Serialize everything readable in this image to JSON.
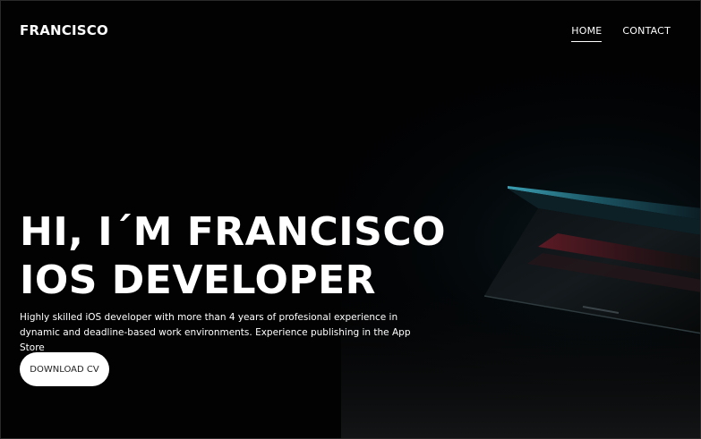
{
  "brand": "FRANCISCO",
  "nav": {
    "home": "HOME",
    "contact": "CONTACT"
  },
  "hero": {
    "line1": "HI, I´M FRANCISCO",
    "line2": "IOS DEVELOPER",
    "description": "Highly skilled iOS developer with more than 4 years of profesional experience in dynamic and deadline-based work environments. Experience publishing in the App Store",
    "cta": "DOWNLOAD CV"
  },
  "colors": {
    "background": "#020203",
    "text": "#ffffff",
    "button_bg": "#ffffff",
    "button_text": "#222222",
    "laptop_glow": "#3fa3b8"
  }
}
